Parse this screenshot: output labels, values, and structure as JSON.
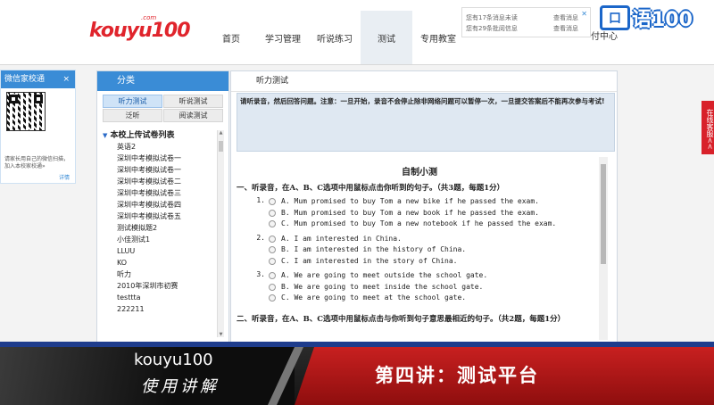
{
  "header": {
    "logo_text": "kouyu100",
    "logo_suffix": ".com",
    "nav": [
      "首页",
      "学习管理",
      "听说练习",
      "测试",
      "专用教室"
    ],
    "nav_active_index": 3,
    "nav_more": "付中心",
    "notices": [
      {
        "text": "您有17条消息未读",
        "link": "查看消息"
      },
      {
        "text": "您有29条批阅信息",
        "link": "查看消息"
      }
    ],
    "brand_box": "口",
    "brand_text": "语100"
  },
  "wechat": {
    "title": "微信家校通",
    "close": "×",
    "desc": "请家长用自己的微信扫描，加入本校家校通»",
    "link": "详情"
  },
  "category": {
    "title": "分类",
    "tabs": [
      "听力测试",
      "听说测试",
      "泛听",
      "阅读测试"
    ],
    "active_tab": 0,
    "tree_title": "本校上传试卷列表",
    "items": [
      "英语2",
      "深圳中考模拟试卷一",
      "深圳中考模拟试卷一",
      "深圳中考模拟试卷二",
      "深圳中考模拟试卷三",
      "深圳中考模拟试卷四",
      "深圳中考模拟试卷五",
      "测试模拟题2",
      "小佳测试1",
      "LLUU",
      "KO",
      "听力",
      "2010年深圳市初赛",
      "testtta",
      "222211"
    ]
  },
  "main": {
    "title": "听力测试",
    "instruction": "请听录音，然后回答问题。注意：一旦开始，录音不会停止除非网络问题可以暂停一次，一旦提交答案后不能再次参与考试!",
    "paper_title": "自制小测",
    "section1": "一、听录音，在A、B、C选项中用鼠标点击你听到的句子。（共3题，每题1分）",
    "questions": [
      {
        "num": "1.",
        "options": [
          "A. Mum promised to buy Tom a new bike if he passed the exam.",
          "B. Mum promised to buy Tom a new book if he passed the exam.",
          "C. Mum promised to buy Tom a new notebook if he passed the exam."
        ]
      },
      {
        "num": "2.",
        "options": [
          "A. I am interested in China.",
          "B. I am interested in the history of China.",
          "C. I am interested in the story of China."
        ]
      },
      {
        "num": "3.",
        "options": [
          "A. We are going to meet outside the school gate.",
          "B. We are going to meet inside the school gate.",
          "C. We are going to meet at the school gate."
        ]
      }
    ],
    "section2": "二、听录音，在A、B、C选项中用鼠标点击与你听到句子意思最相近的句子。（共2题，每题1分）"
  },
  "side_tab": "在线客服<<",
  "banner": {
    "left_line1": "kouyu100",
    "left_line2": "使用讲解",
    "right": "第四讲：测试平台"
  }
}
